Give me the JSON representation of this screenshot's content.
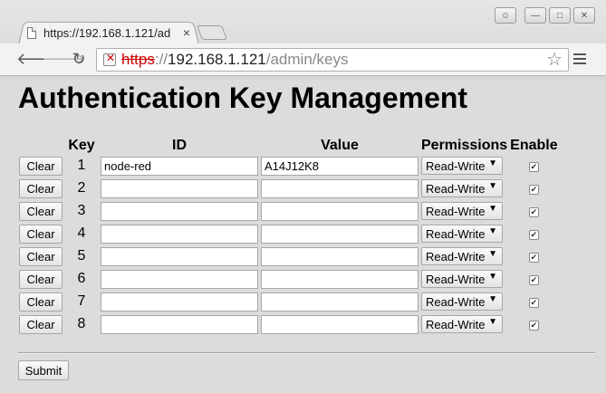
{
  "browser": {
    "tab_title": "https://192.168.1.121/ad",
    "tab_close": "×",
    "url_scheme": "https",
    "url_sep": "://",
    "url_host": "192.168.1.121",
    "url_path": "/admin/keys"
  },
  "page": {
    "title": "Authentication Key Management",
    "headers": {
      "key": "Key",
      "id": "ID",
      "value": "Value",
      "permissions": "Permissions",
      "enable": "Enable"
    },
    "clear_label": "Clear",
    "submit_label": "Submit",
    "rows": [
      {
        "key": "1",
        "id": "node-red",
        "value": "A14J12K8",
        "permission": "Read-Write",
        "enabled": true
      },
      {
        "key": "2",
        "id": "",
        "value": "",
        "permission": "Read-Write",
        "enabled": true
      },
      {
        "key": "3",
        "id": "",
        "value": "",
        "permission": "Read-Write",
        "enabled": true
      },
      {
        "key": "4",
        "id": "",
        "value": "",
        "permission": "Read-Write",
        "enabled": true
      },
      {
        "key": "5",
        "id": "",
        "value": "",
        "permission": "Read-Write",
        "enabled": true
      },
      {
        "key": "6",
        "id": "",
        "value": "",
        "permission": "Read-Write",
        "enabled": true
      },
      {
        "key": "7",
        "id": "",
        "value": "",
        "permission": "Read-Write",
        "enabled": true
      },
      {
        "key": "8",
        "id": "",
        "value": "",
        "permission": "Read-Write",
        "enabled": true
      }
    ]
  }
}
